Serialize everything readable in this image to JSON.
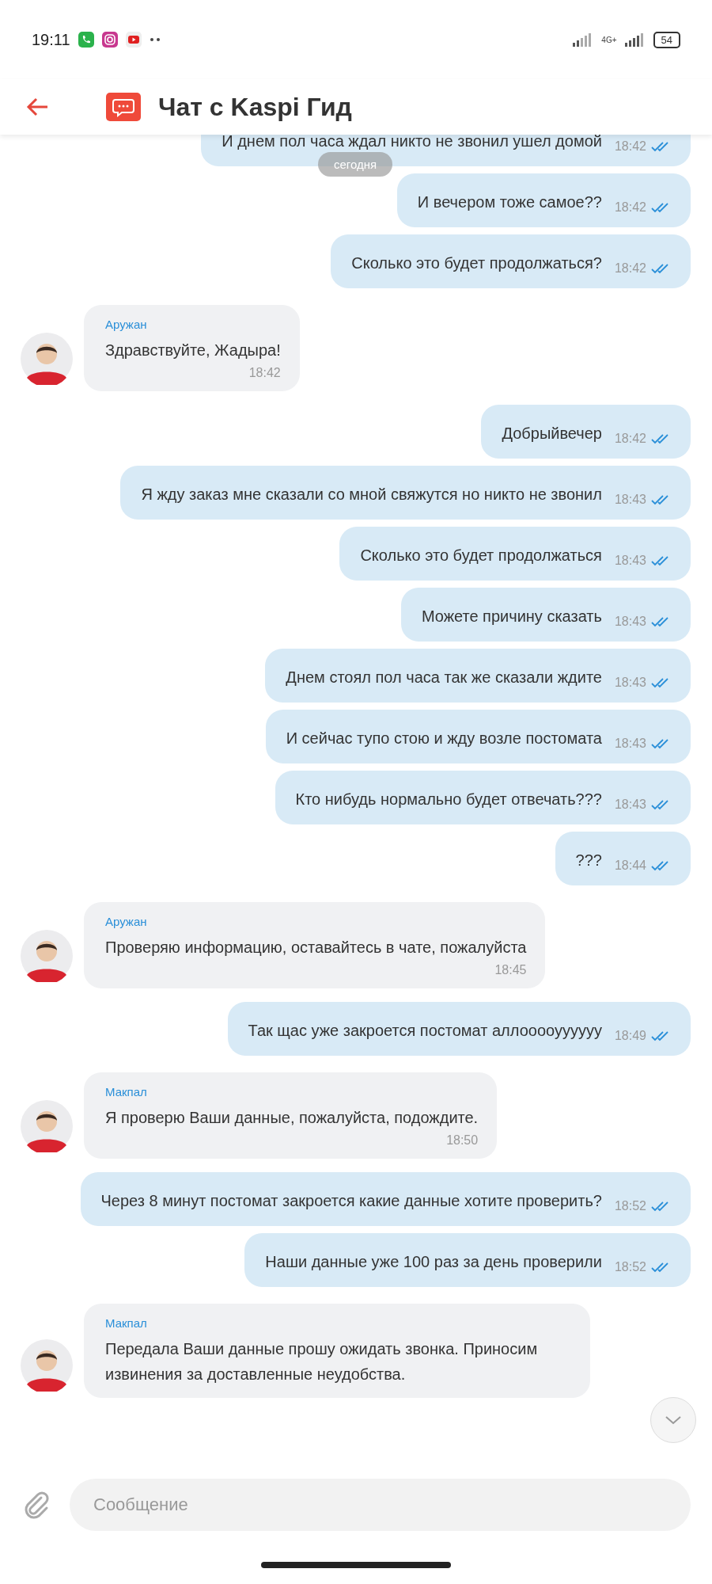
{
  "status_bar": {
    "time": "19:11",
    "network": "4G+",
    "battery": "54"
  },
  "header": {
    "title": "Чат с Kaspi Гид"
  },
  "date_divider": "сегодня",
  "messages": [
    {
      "kind": "outgoing",
      "text": "И днем пол часа ждал никто не звонил ушел домой",
      "time": "18:42"
    },
    {
      "kind": "outgoing",
      "text": "И вечером тоже самое??",
      "time": "18:42"
    },
    {
      "kind": "outgoing",
      "text": "Сколько это будет продолжаться?",
      "time": "18:42"
    },
    {
      "kind": "incoming",
      "sender": "Аружан",
      "text": "Здравствуйте, Жадыра!",
      "time": "18:42"
    },
    {
      "kind": "outgoing",
      "text": "Добрыйвечер",
      "time": "18:42"
    },
    {
      "kind": "outgoing",
      "text": "Я жду заказ мне сказали со мной свяжутся но никто не звонил",
      "time": "18:43"
    },
    {
      "kind": "outgoing",
      "text": "Сколько это будет продолжаться",
      "time": "18:43"
    },
    {
      "kind": "outgoing",
      "text": "Можете причину сказать",
      "time": "18:43"
    },
    {
      "kind": "outgoing",
      "text": "Днем стоял пол часа так же сказали ждите",
      "time": "18:43"
    },
    {
      "kind": "outgoing",
      "text": "И сейчас тупо стою и жду возле постомата",
      "time": "18:43"
    },
    {
      "kind": "outgoing",
      "text": "Кто нибудь нормально будет отвечать???",
      "time": "18:43"
    },
    {
      "kind": "outgoing",
      "text": "???",
      "time": "18:44"
    },
    {
      "kind": "incoming",
      "sender": "Аружан",
      "text": "Проверяю информацию, оставайтесь в чате, пожалуйста",
      "time": "18:45"
    },
    {
      "kind": "outgoing",
      "text": "Так щас уже закроется постомат аллооооуууууу",
      "time": "18:49"
    },
    {
      "kind": "incoming",
      "sender": "Макпал",
      "text": "Я проверю Ваши данные, пожалуйста, подождите.",
      "time": "18:50"
    },
    {
      "kind": "outgoing",
      "text": "Через 8 минут постомат закроется какие данные хотите проверить?",
      "time": "18:52"
    },
    {
      "kind": "outgoing",
      "text": "Наши данные уже 100 раз за день проверили",
      "time": "18:52"
    },
    {
      "kind": "incoming",
      "sender": "Макпал",
      "text": "Передала Ваши данные прошу ожидать звонка. Приносим извинения за доставленные неудобства."
    }
  ],
  "composer": {
    "placeholder": "Сообщение"
  }
}
